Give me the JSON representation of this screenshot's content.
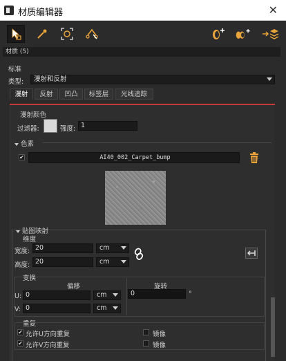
{
  "window": {
    "title": "材质编辑器",
    "close_glyph": "✕"
  },
  "toolbar": {
    "tools": [
      "select-arrow-icon",
      "eyedropper-icon",
      "scan-frame-icon",
      "scissors-icon"
    ],
    "right_tools": [
      "add-material-icon",
      "add-multiple-materials-icon",
      "import-stack-icon"
    ],
    "accent": "#e8a33a"
  },
  "material_header": "材质 (5)",
  "standard": {
    "label": "标准",
    "type_label": "类型:",
    "type_value": "漫射和反射"
  },
  "tabs": [
    "漫射",
    "反射",
    "凹凸",
    "标签层",
    "光线追踪"
  ],
  "diffuse_color": {
    "label": "漫射颜色",
    "filter_label": "过滤器:",
    "strength_label": "强度:",
    "strength_value": "1"
  },
  "texture": {
    "section_label": "色素",
    "name": "AI40_002_Carpet_bump"
  },
  "mapping": {
    "label": "贴图映射",
    "dimension": {
      "label": "维度",
      "width_label": "宽度:",
      "width_value": "20",
      "width_unit": "cm",
      "height_label": "高度:",
      "height_value": "20",
      "height_unit": "cm"
    },
    "transform": {
      "label": "变换",
      "offset_label": "偏移",
      "rotation_label": "旋转",
      "u_label": "U:",
      "u_value": "0",
      "u_unit": "cm",
      "v_label": "V:",
      "v_value": "0",
      "v_unit": "cm",
      "rotation_value": "0",
      "degree": "°"
    },
    "repeat": {
      "label": "重复",
      "allow_u": "允许U方向重复",
      "allow_v": "允许V方向重复",
      "mirror1": "镜像",
      "mirror2": "镜像"
    }
  },
  "colors": {
    "red": "#c43a3a",
    "gold": "#e8a33a"
  }
}
